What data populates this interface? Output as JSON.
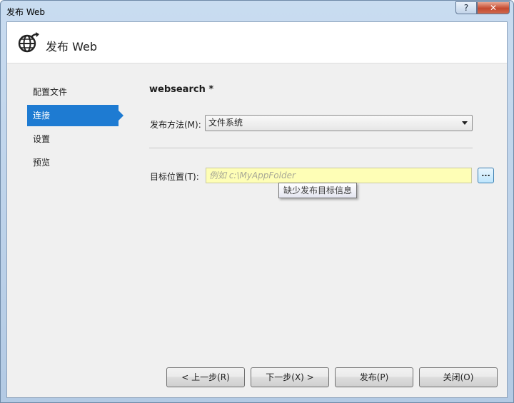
{
  "window": {
    "title": "发布 Web",
    "help_label": "?",
    "close_label": "✕"
  },
  "header": {
    "title": "发布 Web",
    "icon": "globe-publish-icon"
  },
  "nav": {
    "items": [
      {
        "label": "配置文件",
        "active": false
      },
      {
        "label": "连接",
        "active": true
      },
      {
        "label": "设置",
        "active": false
      },
      {
        "label": "预览",
        "active": false
      }
    ]
  },
  "main": {
    "profile_name": "websearch *",
    "publish_method_label": "发布方法(M):",
    "publish_method_value": "文件系统",
    "target_label": "目标位置(T):",
    "target_value": "",
    "target_placeholder": "例如 c:\\MyAppFolder",
    "browse_label": "...",
    "tooltip": "缺少发布目标信息"
  },
  "footer": {
    "prev_label": "< 上一步(R)",
    "next_label": "下一步(X) >",
    "publish_label": "发布(P)",
    "close_label": "关闭(O)"
  },
  "colors": {
    "accent": "#1e7bd2",
    "input_highlight": "#fefeb6"
  }
}
